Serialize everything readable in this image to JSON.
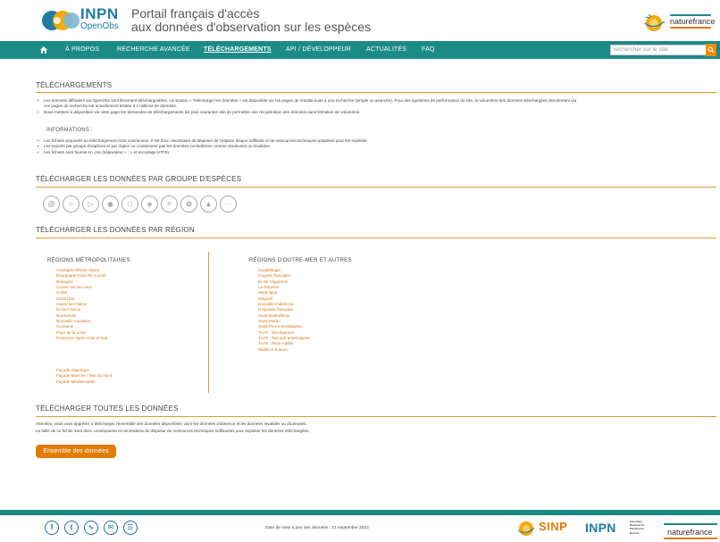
{
  "header": {
    "logo_inpn": "INPN",
    "logo_openobs": "OpenObs",
    "title_line1": "Portail français d'accès",
    "title_line2": "aux données d'observation sur les espèces",
    "naturefrance": "naturefrance"
  },
  "nav": {
    "items": [
      "À PROPOS",
      "RECHERCHE AVANCÉE",
      "TÉLÉCHARGEMENTS",
      "API / DÉVELOPPEUR",
      "ACTUALITÉS",
      "FAQ"
    ],
    "active": "TÉLÉCHARGEMENTS",
    "search_placeholder": "rechercher sur le site"
  },
  "downloads": {
    "title": "TÉLÉCHARGEMENTS",
    "bullets": [
      "Les données diffusées via OpenObs sont librement téléchargeables. Un bouton « Télécharger les données » est disponible sur les pages de résultat suite à une recherche (simple ou avancée). Pour des questions de performance du site, la volumétrie des données téléchargées directement via",
      "ces pages de recherche est actuellement limitée à 2 millions de données.",
      "Nous mettons à disposition via cette page les demandes de téléchargements les plus courantes afin de permettre une récupération des données sans limitation de volumétrie."
    ],
    "info_title": "INFORMATIONS :",
    "info_bullets": [
      "Les fichiers proposés au téléchargement sont volumineux. Il est donc nécessaire de disposer de l'espace disque suffisant et de ressources techniques adaptées pour les exploiter.",
      "Les exports par groupe d'espèces et par région ne contiennent pas les données considérées comme douteuses ou invalides.",
      "Les fichiers sont fournis en .csv (séparateur « ; » et encodage UTF8)."
    ]
  },
  "species": {
    "title": "TÉLÉCHARGER LES DONNÉES PAR GROUPE D'ESPÈCES",
    "icons": [
      "snail-icon",
      "crab-icon",
      "fish-icon",
      "shell-icon",
      "insect-icon",
      "bird-icon",
      "frog-icon",
      "flower-icon",
      "mammal-icon",
      "more-icon"
    ]
  },
  "regions": {
    "title": "TÉLÉCHARGER LES DONNÉES PAR RÉGION",
    "metro_title": "RÉGIONS MÉTROPOLITAINES",
    "metro": [
      "Auvergne-Rhône-Alpes",
      "Bourgogne-Franche-Comté",
      "Bretagne",
      "Centre-Val de Loire",
      "Corse",
      "Grand Est",
      "Hauts-de-France",
      "Île-de-France",
      "Normandie",
      "Nouvelle-Aquitaine",
      "Occitanie",
      "Pays de la Loire",
      "Provence-Alpes-Côte d'Azur"
    ],
    "facades": [
      "Façade Atlantique",
      "Façade Manche / Mer du Nord",
      "Façade Méditerranée"
    ],
    "outremer_title": "RÉGIONS D'OUTRE-MER ET AUTRES",
    "outremer": [
      "Guadeloupe",
      "Guyane française",
      "Île de Clipperton",
      "La Réunion",
      "Martinique",
      "Mayotte",
      "Nouvelle-Calédonie",
      "Polynésie française",
      "Saint-Barthélemy",
      "Saint-Martin",
      "Saint-Pierre-et-Miquelon",
      "TAAF : Îles éparses",
      "TAAF : Îles sub-antarctiques",
      "TAAF : Terre Adélie",
      "Wallis et Futuna"
    ]
  },
  "all": {
    "title": "TÉLÉCHARGER TOUTES LES DONNÉES",
    "warning_1": "Attention, vous vous apprêtez à télécharger l'ensemble des données disponibles, dont les données d'absence et les données invalides ou douteuses.",
    "warning_2": "La taille de ce fichier sera donc conséquente et nécessitera de disposer de ressources techniques suffisantes pour exploiter les données téléchargées.",
    "button": "Ensemble des données"
  },
  "footer": {
    "date": "Date de mise à jour des données : 21 septembre 2023",
    "social": [
      "facebook-icon",
      "twitter-icon",
      "rss-icon",
      "mail-icon",
      "newsletter-icon"
    ],
    "sinp": "SINP",
    "inpn": "INPN",
    "inpn_sub": [
      "Inventaire",
      "National du",
      "Patrimoine",
      "Naturel"
    ],
    "naturefrance": "naturefrance"
  },
  "colors": {
    "teal": "#1b8b87",
    "orange": "#e37b07",
    "blue": "#1f7ba5"
  }
}
